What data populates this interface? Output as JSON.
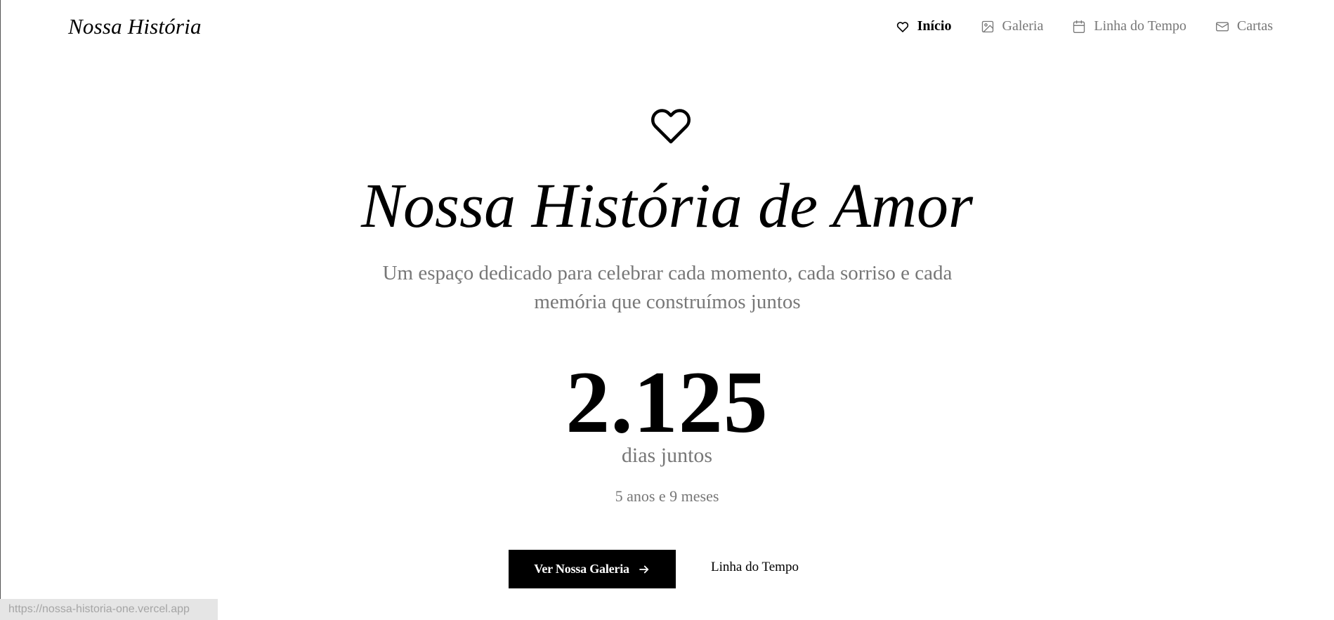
{
  "header": {
    "brand": "Nossa História",
    "nav": [
      {
        "label": "Início",
        "icon": "heart-icon",
        "active": true
      },
      {
        "label": "Galeria",
        "icon": "image-icon",
        "active": false
      },
      {
        "label": "Linha do Tempo",
        "icon": "calendar-icon",
        "active": false
      },
      {
        "label": "Cartas",
        "icon": "mail-icon",
        "active": false
      }
    ]
  },
  "hero": {
    "icon": "heart-icon",
    "title": "Nossa História de Amor",
    "subtitle": "Um espaço dedicado para celebrar cada momento, cada sorriso e cada memória que construímos juntos"
  },
  "counter": {
    "value": "2.125",
    "label": "dias juntos",
    "duration": "5 anos e 9 meses"
  },
  "actions": {
    "primary_label": "Ver Nossa Galeria",
    "primary_icon": "arrow-right-icon",
    "secondary_label": "Linha do Tempo"
  },
  "status_bar": {
    "url": "https://nossa-historia-one.vercel.app"
  },
  "colors": {
    "text": "#000000",
    "muted": "#777777",
    "background": "#ffffff",
    "button_bg": "#000000",
    "button_text": "#ffffff",
    "status_bar_bg": "#e5e5e5"
  }
}
